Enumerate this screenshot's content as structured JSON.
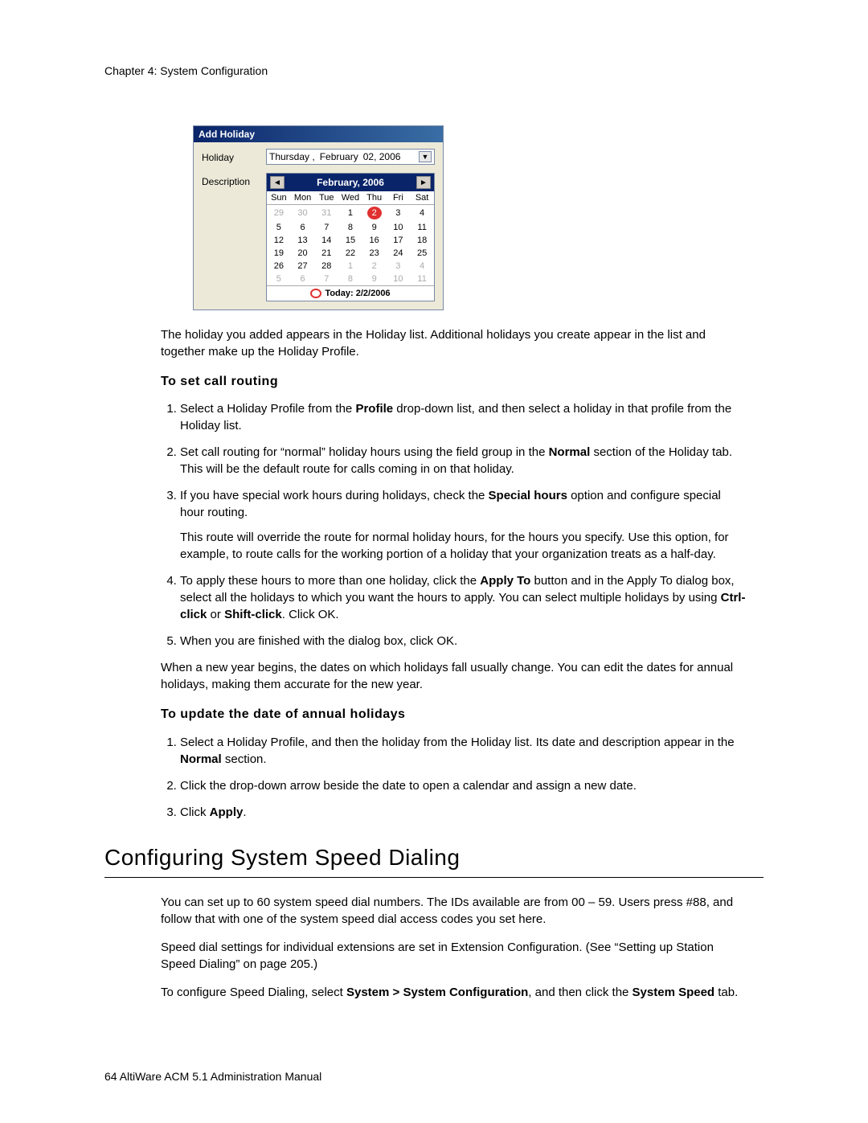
{
  "chapter": "Chapter 4:  System Configuration",
  "dialog": {
    "title": "Add Holiday",
    "labels": {
      "holiday": "Holiday",
      "description": "Description"
    },
    "dateValue": [
      "Thursday ,",
      "February",
      "02, 2006"
    ],
    "calendar": {
      "monthYear": "February, 2006",
      "dow": [
        "Sun",
        "Mon",
        "Tue",
        "Wed",
        "Thu",
        "Fri",
        "Sat"
      ],
      "weeks": [
        [
          {
            "d": "29",
            "g": true
          },
          {
            "d": "30",
            "g": true
          },
          {
            "d": "31",
            "g": true
          },
          {
            "d": "1"
          },
          {
            "d": "2",
            "today": true
          },
          {
            "d": "3"
          },
          {
            "d": "4"
          }
        ],
        [
          {
            "d": "5"
          },
          {
            "d": "6"
          },
          {
            "d": "7"
          },
          {
            "d": "8"
          },
          {
            "d": "9"
          },
          {
            "d": "10"
          },
          {
            "d": "11"
          }
        ],
        [
          {
            "d": "12"
          },
          {
            "d": "13"
          },
          {
            "d": "14"
          },
          {
            "d": "15"
          },
          {
            "d": "16"
          },
          {
            "d": "17"
          },
          {
            "d": "18"
          }
        ],
        [
          {
            "d": "19"
          },
          {
            "d": "20"
          },
          {
            "d": "21"
          },
          {
            "d": "22"
          },
          {
            "d": "23"
          },
          {
            "d": "24"
          },
          {
            "d": "25"
          }
        ],
        [
          {
            "d": "26"
          },
          {
            "d": "27"
          },
          {
            "d": "28"
          },
          {
            "d": "1",
            "g": true
          },
          {
            "d": "2",
            "g": true
          },
          {
            "d": "3",
            "g": true
          },
          {
            "d": "4",
            "g": true
          }
        ],
        [
          {
            "d": "5",
            "g": true
          },
          {
            "d": "6",
            "g": true
          },
          {
            "d": "7",
            "g": true
          },
          {
            "d": "8",
            "g": true
          },
          {
            "d": "9",
            "g": true
          },
          {
            "d": "10",
            "g": true
          },
          {
            "d": "11",
            "g": true
          }
        ]
      ],
      "todayLabel": "Today: 2/2/2006"
    }
  },
  "text": {
    "afterDialog": "The holiday you added appears in the Holiday list. Additional holidays you create appear in the list and together make up the Holiday Profile.",
    "sub1": "To set call routing",
    "s1_1a": "Select a Holiday Profile from the ",
    "s1_1b": "Profile",
    "s1_1c": " drop-down list, and then select a holiday in that profile from the Holiday list.",
    "s1_2a": "Set call routing for “normal” holiday hours using the field group in the ",
    "s1_2b": "Normal",
    "s1_2c": " section of the Holiday tab. This will be the default route for calls coming in on that holiday.",
    "s1_3a": "If you have special work hours during holidays, check the ",
    "s1_3b": "Special hours",
    "s1_3c": " option and configure special hour routing.",
    "s1_3sub": "This route will override the route for normal holiday hours, for the hours you specify. Use this option, for example, to route calls for the working portion of a holiday that your organization treats as a half-day.",
    "s1_4a": "To apply these hours to more than one holiday, click the ",
    "s1_4b": "Apply To",
    "s1_4c": " button and in the Apply To dialog box, select all the holidays to which you want the hours to apply. You can select multiple holidays by using ",
    "s1_4d": "Ctrl-click",
    "s1_4e": " or ",
    "s1_4f": "Shift-click",
    "s1_4g": ". Click OK.",
    "s1_5": "When you are finished with the dialog box, click OK.",
    "afterSteps1": "When a new year begins, the dates on which holidays fall usually change. You can edit the dates for annual holidays, making them accurate for the new year.",
    "sub2": "To update the date of annual holidays",
    "s2_1a": "Select a Holiday Profile, and then the holiday from the Holiday list. Its date and description appear in the ",
    "s2_1b": "Normal",
    "s2_1c": " section.",
    "s2_2": "Click the drop-down arrow beside the date to open a calendar and assign a new date.",
    "s2_3a": "Click ",
    "s2_3b": "Apply",
    "s2_3c": ".",
    "h2": "Configuring System Speed Dialing",
    "p2a": "You can set up to 60 system speed dial numbers. The IDs available are from 00 – 59. Users press #88, and follow that with one of the system speed dial access codes you set here.",
    "p2b": "Speed dial settings for individual extensions are set in Extension Configuration. (See “Setting up Station Speed Dialing” on page 205.)",
    "p2c_a": "To configure Speed Dialing, select ",
    "p2c_b": "System > System Configuration",
    "p2c_c": ", and then click the ",
    "p2c_d": "System Speed",
    "p2c_e": " tab.",
    "footer_page": "64",
    "footer_text": "   AltiWare ACM 5.1 Administration Manual"
  }
}
